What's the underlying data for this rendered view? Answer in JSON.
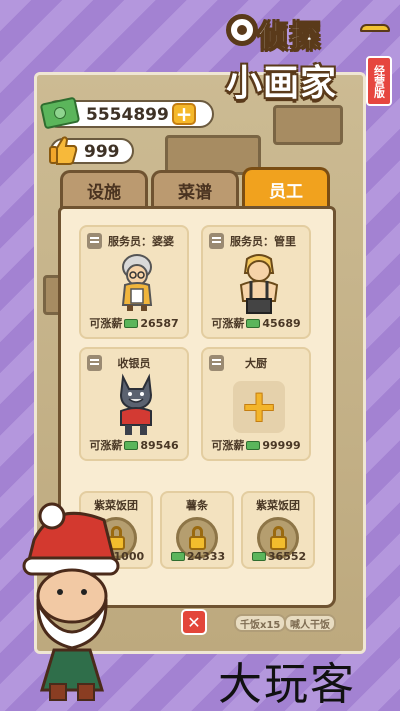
{
  "logo": {
    "line1": "侦探",
    "line2": "小画家",
    "badge": "经营版"
  },
  "resources": {
    "money": "5554899",
    "likes": "999"
  },
  "tabs": [
    {
      "label": "设施",
      "active": false
    },
    {
      "label": "菜谱",
      "active": false
    },
    {
      "label": "员工",
      "active": true
    }
  ],
  "staff": [
    {
      "title": "服务员：婆婆",
      "salary_label": "可涨薪",
      "salary": "26587"
    },
    {
      "title": "服务员：管里",
      "salary_label": "可涨薪",
      "salary": "45689"
    },
    {
      "title": "收银员",
      "salary_label": "可涨薪",
      "salary": "89546"
    },
    {
      "title": "大厨",
      "salary_label": "可涨薪",
      "salary": "99999"
    }
  ],
  "locked": [
    {
      "title": "紫菜饭团",
      "price": "11000"
    },
    {
      "title": "薯条",
      "price": "24333"
    },
    {
      "title": "紫菜饭团",
      "price": "36552"
    }
  ],
  "bottom_chips": [
    "千饭x15",
    "喊人干饭"
  ],
  "close_label": "✕",
  "watermark": "大玩客",
  "colors": {
    "accent": "#f1a21e",
    "background": "#a98ad6",
    "close": "#e3463a"
  }
}
